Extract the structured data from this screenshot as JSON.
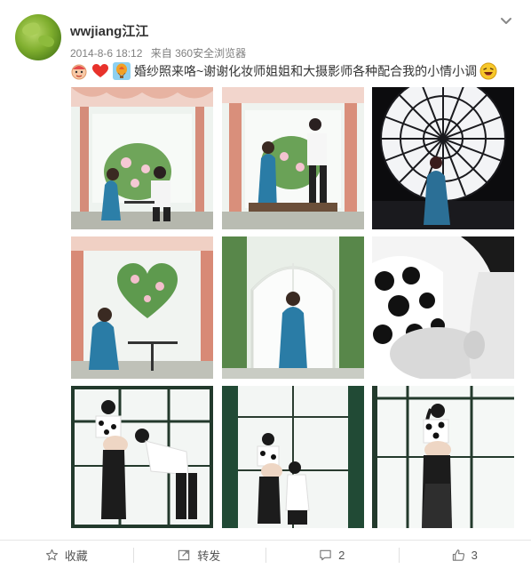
{
  "post": {
    "username": "wwjiang江江",
    "date": "2014-8-6 18:12",
    "source": "来自 360安全浏览器",
    "text": "婚纱照来咯~谢谢化妆师姐姐和大摄影师各种配合我的小情小调",
    "emoji_start": [
      "baby-face-icon",
      "heart-icon",
      "hot-air-balloon-icon"
    ],
    "emoji_end": "laughing-face-icon",
    "photos": [
      "photo-1",
      "photo-2",
      "photo-3",
      "photo-4",
      "photo-5",
      "photo-6",
      "photo-7",
      "photo-8",
      "photo-9"
    ]
  },
  "actions": {
    "favorite_label": "收藏",
    "repost_label": "转发",
    "comment_count": "2",
    "like_count": "3"
  },
  "colors": {
    "link_blue": "#eb7350",
    "meta_gray": "#808080",
    "divider": "#e6e6e6"
  }
}
